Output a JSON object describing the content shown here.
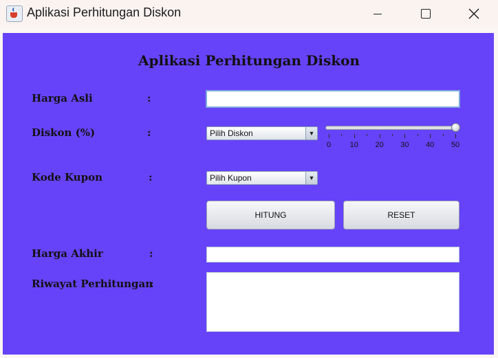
{
  "window": {
    "title": "Aplikasi Perhitungan Diskon",
    "controls": [
      "minimize",
      "maximize",
      "close"
    ]
  },
  "form": {
    "heading": "Aplikasi Perhitungan Diskon",
    "colon": ":",
    "harga_asli": {
      "label": "Harga Asli",
      "value": ""
    },
    "diskon": {
      "label": "Diskon (%)",
      "combo_value": "Pilih Diskon",
      "slider": {
        "min": 0,
        "max": 50,
        "value": 50,
        "tick_labels": [
          "0",
          "10",
          "20",
          "30",
          "40",
          "50"
        ]
      }
    },
    "kode_kupon": {
      "label": "Kode Kupon",
      "combo_value": "Pilih Kupon"
    },
    "buttons": {
      "hitung": "HITUNG",
      "reset": "RESET"
    },
    "harga_akhir": {
      "label": "Harga Akhir",
      "value": ""
    },
    "riwayat": {
      "label": "Riwayat Perhitungan",
      "value": ""
    }
  },
  "colors": {
    "panel": "#6643f8",
    "titlebar": "#faf3f0"
  },
  "icons": {
    "app": "java-cup-icon",
    "dropdown": "dropdown-arrow-icon"
  }
}
